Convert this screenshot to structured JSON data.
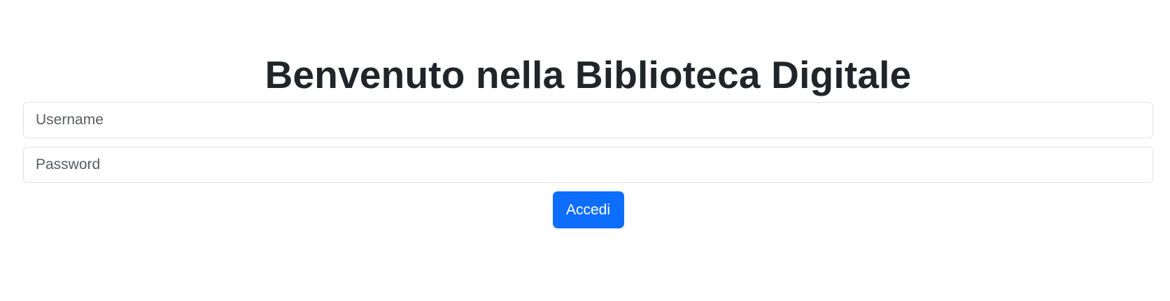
{
  "page": {
    "title": "Benvenuto nella Biblioteca Digitale"
  },
  "form": {
    "username": {
      "value": "",
      "placeholder": "Username"
    },
    "password": {
      "value": "",
      "placeholder": "Password"
    },
    "submit_label": "Accedi"
  },
  "colors": {
    "text": "#212529",
    "input_border": "#dee2e6",
    "button_bg": "#0d6efd",
    "button_text": "#ffffff"
  }
}
